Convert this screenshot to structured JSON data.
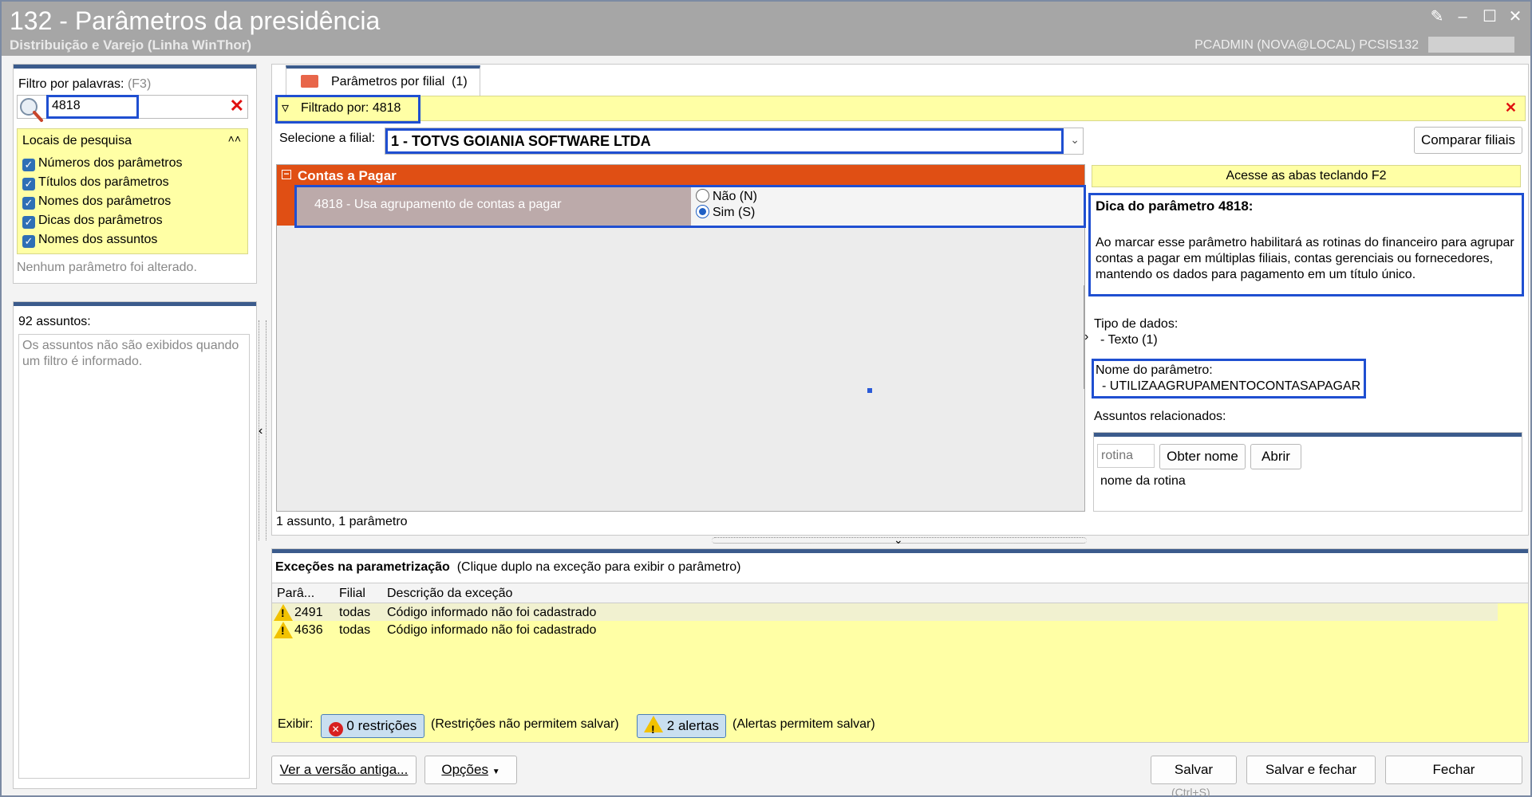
{
  "window": {
    "title": "132 - Parâmetros da presidência",
    "subtitle": "Distribuição e Varejo (Linha WinThor)",
    "user_info": "PCADMIN (NOVA@LOCAL)   PCSIS132",
    "controls": [
      "restore-icon",
      "minimize-icon",
      "maximize-icon",
      "close-icon"
    ]
  },
  "filter": {
    "label": "Filtro por palavras:",
    "shortcut": "(F3)",
    "value": "4818",
    "search_locations_title": "Locais de pesquisa",
    "options": [
      {
        "label": "Números dos parâmetros",
        "checked": true
      },
      {
        "label": "Títulos dos parâmetros",
        "checked": true
      },
      {
        "label": "Nomes dos parâmetros",
        "checked": true
      },
      {
        "label": "Dicas dos parâmetros",
        "checked": true
      },
      {
        "label": "Nomes dos assuntos",
        "checked": true
      }
    ],
    "status": "Nenhum parâmetro foi alterado."
  },
  "subjects": {
    "count_label": "92 assuntos:",
    "info": "Os assuntos não são exibidos quando um filtro é informado."
  },
  "tab": {
    "label": "Parâmetros por filial",
    "count": "(1)"
  },
  "filtered_by": "Filtrado por: 4818",
  "branch": {
    "label": "Selecione a filial:",
    "value": "1 - TOTVS GOIANIA SOFTWARE LTDA",
    "compare_button": "Comparar filiais"
  },
  "group": {
    "title": "Contas a Pagar",
    "parameter": {
      "label": "4818 - Usa agrupamento de contas a pagar",
      "options": [
        {
          "label": "Não (N)",
          "selected": false
        },
        {
          "label": "Sim (S)",
          "selected": true
        }
      ]
    }
  },
  "summary": "1 assunto, 1 parâmetro",
  "hint": {
    "tabs_tip": "Acesse as abas teclando F2",
    "title": "Dica do parâmetro 4818:",
    "text": "Ao marcar esse parâmetro habilitará as rotinas do financeiro para agrupar contas a pagar em múltiplas filiais, contas gerenciais ou fornecedores, mantendo os dados para pagamento em um título único.",
    "data_type_label": "Tipo de dados:",
    "data_type_value": "- Texto (1)",
    "name_label": "Nome do parâmetro:",
    "name_value": "- UTILIZAAGRUPAMENTOCONTASAPAGAR",
    "related_label": "Assuntos relacionados:"
  },
  "routine": {
    "placeholder": "rotina",
    "get_name_button": "Obter nome",
    "open_button": "Abrir",
    "name_label": "nome da rotina"
  },
  "exceptions": {
    "title": "Exceções na parametrização",
    "hint": "(Clique duplo na exceção para exibir o parâmetro)",
    "columns": [
      "Parâ...",
      "Filial",
      "Descrição da exceção"
    ],
    "rows": [
      {
        "param": "2491",
        "branch": "todas",
        "description": "Código informado não foi cadastrado"
      },
      {
        "param": "4636",
        "branch": "todas",
        "description": "Código informado não foi cadastrado"
      }
    ],
    "show_label": "Exibir:",
    "restrictions_button": "0 restrições",
    "restrictions_note": "(Restrições não permitem salvar)",
    "alerts_button": "2 alertas",
    "alerts_note": "(Alertas permitem salvar)"
  },
  "footer": {
    "old_version_button": "Ver a versão antiga...",
    "options_button": "Opções",
    "save_button": "Salvar",
    "save_shortcut": "(Ctrl+S)",
    "save_close_button": "Salvar e fechar",
    "close_button": "Fechar"
  },
  "colors": {
    "group_header": "#e04f14",
    "highlight": "#1f4fd1",
    "yellow": "#ffffa5",
    "titlebar": "#a6a6a6"
  }
}
